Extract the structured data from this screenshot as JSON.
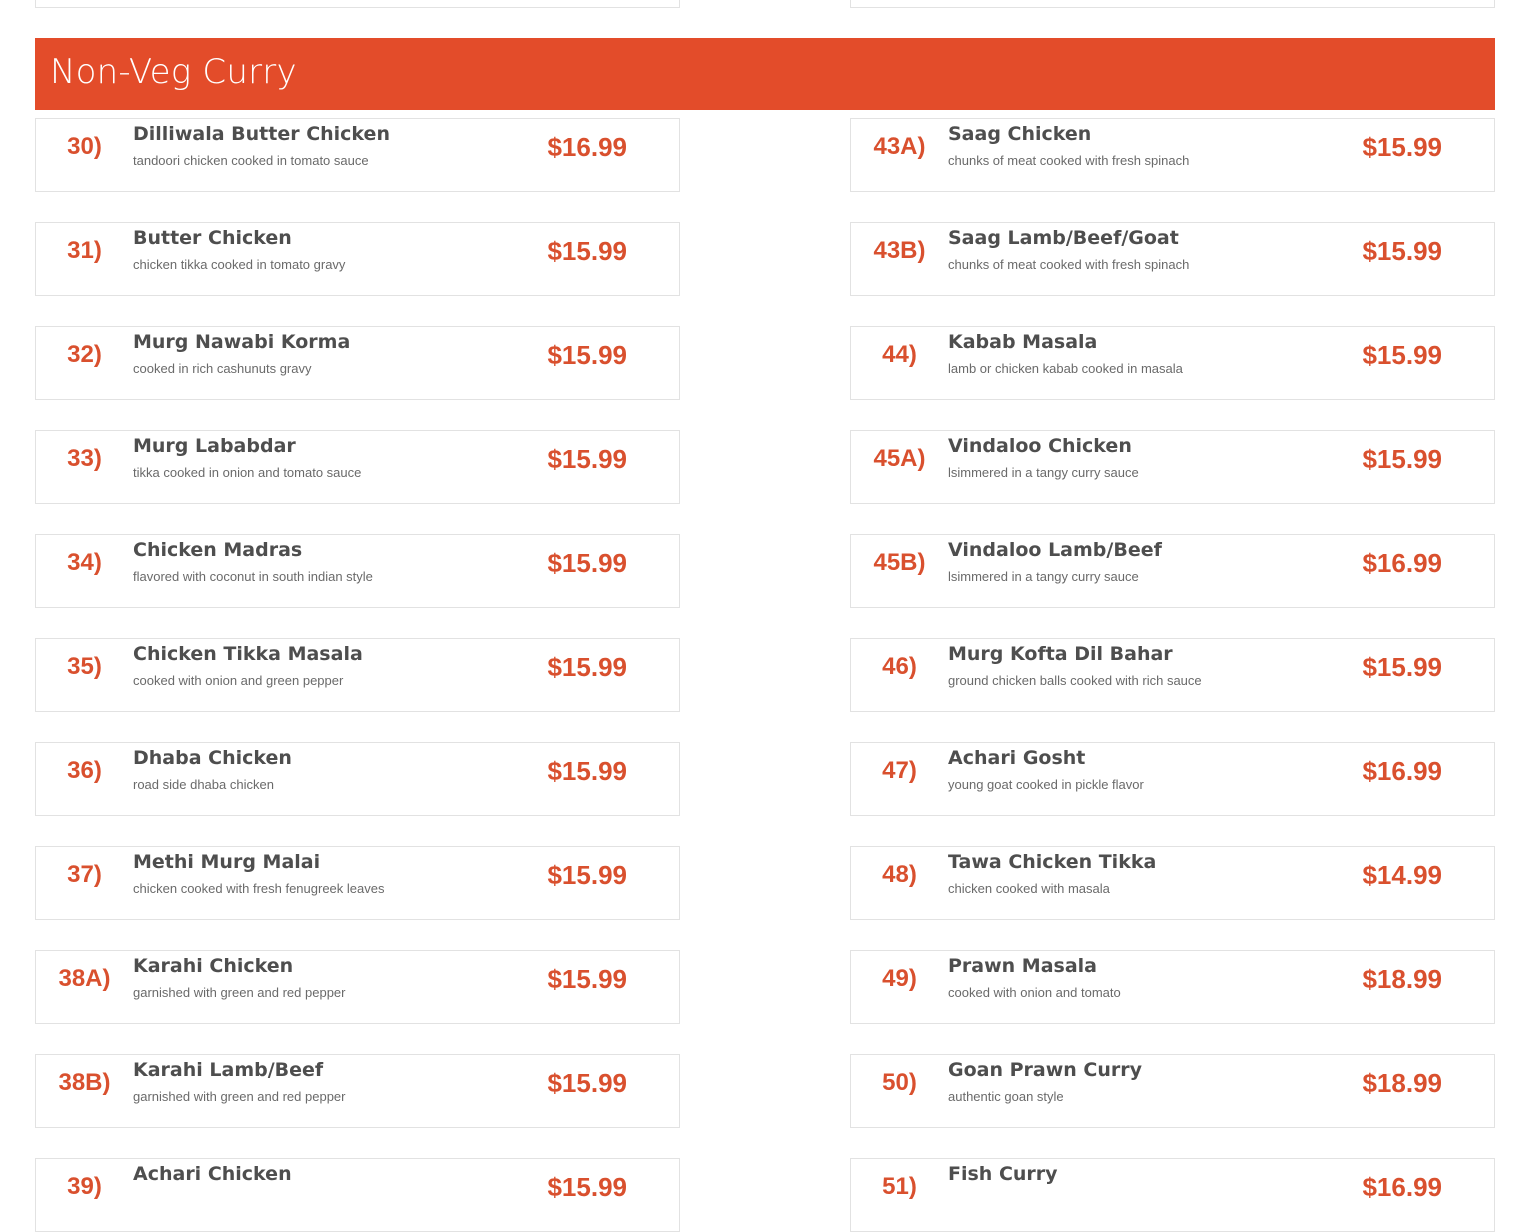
{
  "section": {
    "title": "Non-Veg Curry"
  },
  "colors": {
    "accent": "#e34c2a",
    "price": "#d9502e",
    "name": "#4e4e4e",
    "desc": "#6a6a6a",
    "border": "#e2e2e2"
  },
  "left_items": [
    {
      "num": "30)",
      "name": "Dilliwala Butter Chicken",
      "desc": "tandoori chicken cooked in tomato sauce",
      "price": "$16.99"
    },
    {
      "num": "31)",
      "name": "Butter Chicken",
      "desc": "chicken tikka cooked in tomato gravy",
      "price": "$15.99"
    },
    {
      "num": "32)",
      "name": "Murg Nawabi Korma",
      "desc": "cooked in rich cashunuts gravy",
      "price": "$15.99"
    },
    {
      "num": "33)",
      "name": "Murg Lababdar",
      "desc": "tikka cooked in onion and tomato sauce",
      "price": "$15.99"
    },
    {
      "num": "34)",
      "name": "Chicken Madras",
      "desc": "flavored with coconut in south indian style",
      "price": "$15.99"
    },
    {
      "num": "35)",
      "name": "Chicken Tikka Masala",
      "desc": "cooked with onion and green pepper",
      "price": "$15.99"
    },
    {
      "num": "36)",
      "name": "Dhaba Chicken",
      "desc": "road side dhaba chicken",
      "price": "$15.99"
    },
    {
      "num": "37)",
      "name": "Methi Murg Malai",
      "desc": "chicken cooked with fresh fenugreek leaves",
      "price": "$15.99"
    },
    {
      "num": "38A)",
      "name": "Karahi Chicken",
      "desc": "garnished with green and red pepper",
      "price": "$15.99"
    },
    {
      "num": "38B)",
      "name": "Karahi Lamb/Beef",
      "desc": "garnished with green and red pepper",
      "price": "$15.99"
    },
    {
      "num": "39)",
      "name": "Achari Chicken",
      "desc": "",
      "price": "$15.99"
    }
  ],
  "right_items": [
    {
      "num": "43A)",
      "name": "Saag Chicken",
      "desc": "chunks of meat cooked with fresh spinach",
      "price": "$15.99"
    },
    {
      "num": "43B)",
      "name": "Saag Lamb/Beef/Goat",
      "desc": "chunks of meat cooked with fresh spinach",
      "price": "$15.99"
    },
    {
      "num": "44)",
      "name": "Kabab Masala",
      "desc": "lamb or chicken kabab cooked in masala",
      "price": "$15.99"
    },
    {
      "num": "45A)",
      "name": "Vindaloo Chicken",
      "desc": "lsimmered in a tangy curry sauce",
      "price": "$15.99"
    },
    {
      "num": "45B)",
      "name": "Vindaloo Lamb/Beef",
      "desc": "lsimmered in a tangy curry sauce",
      "price": "$16.99"
    },
    {
      "num": "46)",
      "name": "Murg Kofta Dil Bahar",
      "desc": "ground chicken balls cooked with rich sauce",
      "price": "$15.99"
    },
    {
      "num": "47)",
      "name": "Achari Gosht",
      "desc": "young goat cooked in pickle flavor",
      "price": "$16.99"
    },
    {
      "num": "48)",
      "name": "Tawa Chicken Tikka",
      "desc": "chicken cooked with masala",
      "price": "$14.99"
    },
    {
      "num": "49)",
      "name": "Prawn Masala",
      "desc": "cooked with onion and tomato",
      "price": "$18.99"
    },
    {
      "num": "50)",
      "name": "Goan Prawn Curry",
      "desc": "authentic goan style",
      "price": "$18.99"
    },
    {
      "num": "51)",
      "name": "Fish Curry",
      "desc": "",
      "price": "$16.99"
    }
  ]
}
